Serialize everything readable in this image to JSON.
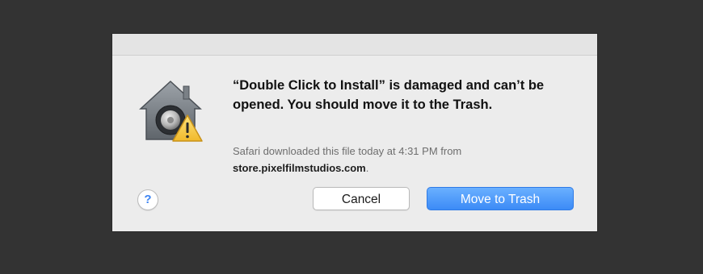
{
  "dialog": {
    "message": "“Double Click to Install” is damaged and can’t be opened. You should move it to the Trash.",
    "info_text": "Safari downloaded this file today at 4:31 PM from",
    "info_domain": "store.pixelfilmstudios.com",
    "info_period": ".",
    "help_label": "?",
    "cancel_label": "Cancel",
    "trash_label": "Move to Trash"
  },
  "icons": {
    "app_icon": "gatekeeper-house-warning-icon"
  },
  "colors": {
    "accent": "#3c8bf6",
    "warning": "#f6c543",
    "help": "#3d84f2"
  }
}
